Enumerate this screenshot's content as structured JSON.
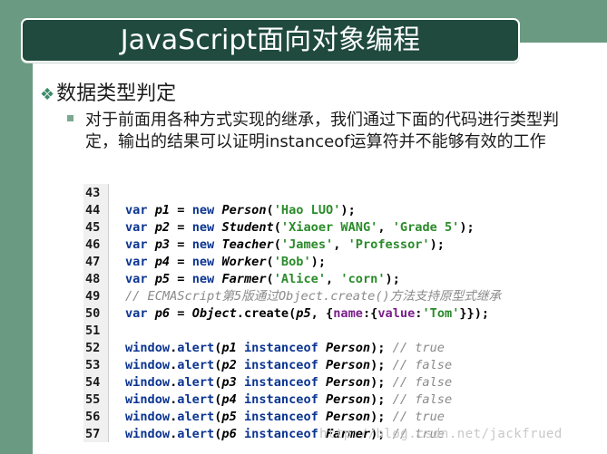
{
  "slide": {
    "title": "JavaScript面向对象编程",
    "heading": "数据类型判定",
    "bullet_text": "对于前面用各种方式实现的继承，我们通过下面的代码进行类型判定，输出的结果可以证明instanceof运算符并不能够有效的工作",
    "watermark": "http://blog.csdn.net/jackfrued"
  },
  "colors": {
    "accent": "#6a9b82",
    "title_bg": "#1f4a3d",
    "keyword": "#0c3591",
    "string": "#2a8b2a",
    "comment": "#8a8a8a"
  },
  "code": {
    "line_numbers": [
      "43",
      "44",
      "45",
      "46",
      "47",
      "48",
      "49",
      "50",
      "51",
      "52",
      "53",
      "54",
      "55",
      "56",
      "57"
    ],
    "lines": [
      [],
      [
        {
          "t": "var",
          "c": "kw"
        },
        {
          "t": " "
        },
        {
          "t": "p1",
          "c": "var"
        },
        {
          "t": " = "
        },
        {
          "t": "new",
          "c": "kw"
        },
        {
          "t": " "
        },
        {
          "t": "Person",
          "c": "fn"
        },
        {
          "t": "("
        },
        {
          "t": "'Hao LUO'",
          "c": "str"
        },
        {
          "t": ");"
        }
      ],
      [
        {
          "t": "var",
          "c": "kw"
        },
        {
          "t": " "
        },
        {
          "t": "p2",
          "c": "var"
        },
        {
          "t": " = "
        },
        {
          "t": "new",
          "c": "kw"
        },
        {
          "t": " "
        },
        {
          "t": "Student",
          "c": "fn"
        },
        {
          "t": "("
        },
        {
          "t": "'Xiaoer WANG'",
          "c": "str"
        },
        {
          "t": ", "
        },
        {
          "t": "'Grade 5'",
          "c": "str"
        },
        {
          "t": ");"
        }
      ],
      [
        {
          "t": "var",
          "c": "kw"
        },
        {
          "t": " "
        },
        {
          "t": "p3",
          "c": "var"
        },
        {
          "t": " = "
        },
        {
          "t": "new",
          "c": "kw"
        },
        {
          "t": " "
        },
        {
          "t": "Teacher",
          "c": "fn"
        },
        {
          "t": "("
        },
        {
          "t": "'James'",
          "c": "str"
        },
        {
          "t": ", "
        },
        {
          "t": "'Professor'",
          "c": "str"
        },
        {
          "t": ");"
        }
      ],
      [
        {
          "t": "var",
          "c": "kw"
        },
        {
          "t": " "
        },
        {
          "t": "p4",
          "c": "var"
        },
        {
          "t": " = "
        },
        {
          "t": "new",
          "c": "kw"
        },
        {
          "t": " "
        },
        {
          "t": "Worker",
          "c": "fn"
        },
        {
          "t": "("
        },
        {
          "t": "'Bob'",
          "c": "str"
        },
        {
          "t": ");"
        }
      ],
      [
        {
          "t": "var",
          "c": "kw"
        },
        {
          "t": " "
        },
        {
          "t": "p5",
          "c": "var"
        },
        {
          "t": " = "
        },
        {
          "t": "new",
          "c": "kw"
        },
        {
          "t": " "
        },
        {
          "t": "Farmer",
          "c": "fn"
        },
        {
          "t": "("
        },
        {
          "t": "'Alice'",
          "c": "str"
        },
        {
          "t": ", "
        },
        {
          "t": "'corn'",
          "c": "str"
        },
        {
          "t": ");"
        }
      ],
      [
        {
          "t": "// ECMAScript第5版通过Object.create()方法支持原型式继承",
          "c": "cmt"
        }
      ],
      [
        {
          "t": "var",
          "c": "kw"
        },
        {
          "t": " "
        },
        {
          "t": "p6",
          "c": "var"
        },
        {
          "t": " = "
        },
        {
          "t": "Object",
          "c": "fn"
        },
        {
          "t": ".create("
        },
        {
          "t": "p5",
          "c": "var"
        },
        {
          "t": ", {"
        },
        {
          "t": "name",
          "c": "prop"
        },
        {
          "t": ":{"
        },
        {
          "t": "value",
          "c": "prop"
        },
        {
          "t": ":"
        },
        {
          "t": "'Tom'",
          "c": "str"
        },
        {
          "t": "}});"
        }
      ],
      [],
      [
        {
          "t": "window",
          "c": "kw"
        },
        {
          "t": "."
        },
        {
          "t": "alert",
          "c": "kw"
        },
        {
          "t": "("
        },
        {
          "t": "p1",
          "c": "var"
        },
        {
          "t": " "
        },
        {
          "t": "instanceof",
          "c": "kw"
        },
        {
          "t": " "
        },
        {
          "t": "Person",
          "c": "fn"
        },
        {
          "t": "); "
        },
        {
          "t": "// true",
          "c": "cmt"
        }
      ],
      [
        {
          "t": "window",
          "c": "kw"
        },
        {
          "t": "."
        },
        {
          "t": "alert",
          "c": "kw"
        },
        {
          "t": "("
        },
        {
          "t": "p2",
          "c": "var"
        },
        {
          "t": " "
        },
        {
          "t": "instanceof",
          "c": "kw"
        },
        {
          "t": " "
        },
        {
          "t": "Person",
          "c": "fn"
        },
        {
          "t": "); "
        },
        {
          "t": "// false",
          "c": "cmt"
        }
      ],
      [
        {
          "t": "window",
          "c": "kw"
        },
        {
          "t": "."
        },
        {
          "t": "alert",
          "c": "kw"
        },
        {
          "t": "("
        },
        {
          "t": "p3",
          "c": "var"
        },
        {
          "t": " "
        },
        {
          "t": "instanceof",
          "c": "kw"
        },
        {
          "t": " "
        },
        {
          "t": "Person",
          "c": "fn"
        },
        {
          "t": "); "
        },
        {
          "t": "// false",
          "c": "cmt"
        }
      ],
      [
        {
          "t": "window",
          "c": "kw"
        },
        {
          "t": "."
        },
        {
          "t": "alert",
          "c": "kw"
        },
        {
          "t": "("
        },
        {
          "t": "p4",
          "c": "var"
        },
        {
          "t": " "
        },
        {
          "t": "instanceof",
          "c": "kw"
        },
        {
          "t": " "
        },
        {
          "t": "Person",
          "c": "fn"
        },
        {
          "t": "); "
        },
        {
          "t": "// false",
          "c": "cmt"
        }
      ],
      [
        {
          "t": "window",
          "c": "kw"
        },
        {
          "t": "."
        },
        {
          "t": "alert",
          "c": "kw"
        },
        {
          "t": "("
        },
        {
          "t": "p5",
          "c": "var"
        },
        {
          "t": " "
        },
        {
          "t": "instanceof",
          "c": "kw"
        },
        {
          "t": " "
        },
        {
          "t": "Person",
          "c": "fn"
        },
        {
          "t": "); "
        },
        {
          "t": "// true",
          "c": "cmt"
        }
      ],
      [
        {
          "t": "window",
          "c": "kw"
        },
        {
          "t": "."
        },
        {
          "t": "alert",
          "c": "kw"
        },
        {
          "t": "("
        },
        {
          "t": "p6",
          "c": "var"
        },
        {
          "t": " "
        },
        {
          "t": "instanceof",
          "c": "kw"
        },
        {
          "t": " "
        },
        {
          "t": "Farmer",
          "c": "fn"
        },
        {
          "t": "); "
        },
        {
          "t": "// true",
          "c": "cmt"
        }
      ]
    ]
  }
}
